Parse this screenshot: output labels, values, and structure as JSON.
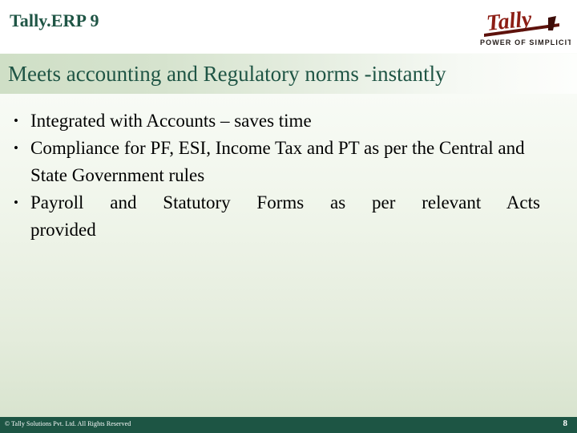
{
  "header": {
    "app_title": "Tally.ERP 9",
    "logo": {
      "wordmark": "Tally",
      "tagline": "POWER OF SIMPLICITY",
      "color": "#8c1d14",
      "dark_color": "#3d0c08"
    }
  },
  "heading": {
    "text": "Meets accounting and Regulatory norms -instantly",
    "color": "#1f5545",
    "band_start_color": "#cfdfc6",
    "band_end_color": "#fdfefc"
  },
  "content": {
    "bullet_marker": "•",
    "bullets": [
      {
        "text": "Integrated with Accounts – saves time",
        "justified": false
      },
      {
        "text": "Compliance for PF, ESI, Income Tax and PT as per the Central and State Government rules",
        "justified": false
      },
      {
        "line1": "Payroll and Statutory Forms as per relevant Acts",
        "line2": "provided",
        "justified": true
      }
    ]
  },
  "footer": {
    "copyright": "© Tally Solutions Pvt. Ltd. All Rights Reserved",
    "page_number": "8",
    "bar_color": "#1d5544",
    "text_color": "#ffffff"
  }
}
